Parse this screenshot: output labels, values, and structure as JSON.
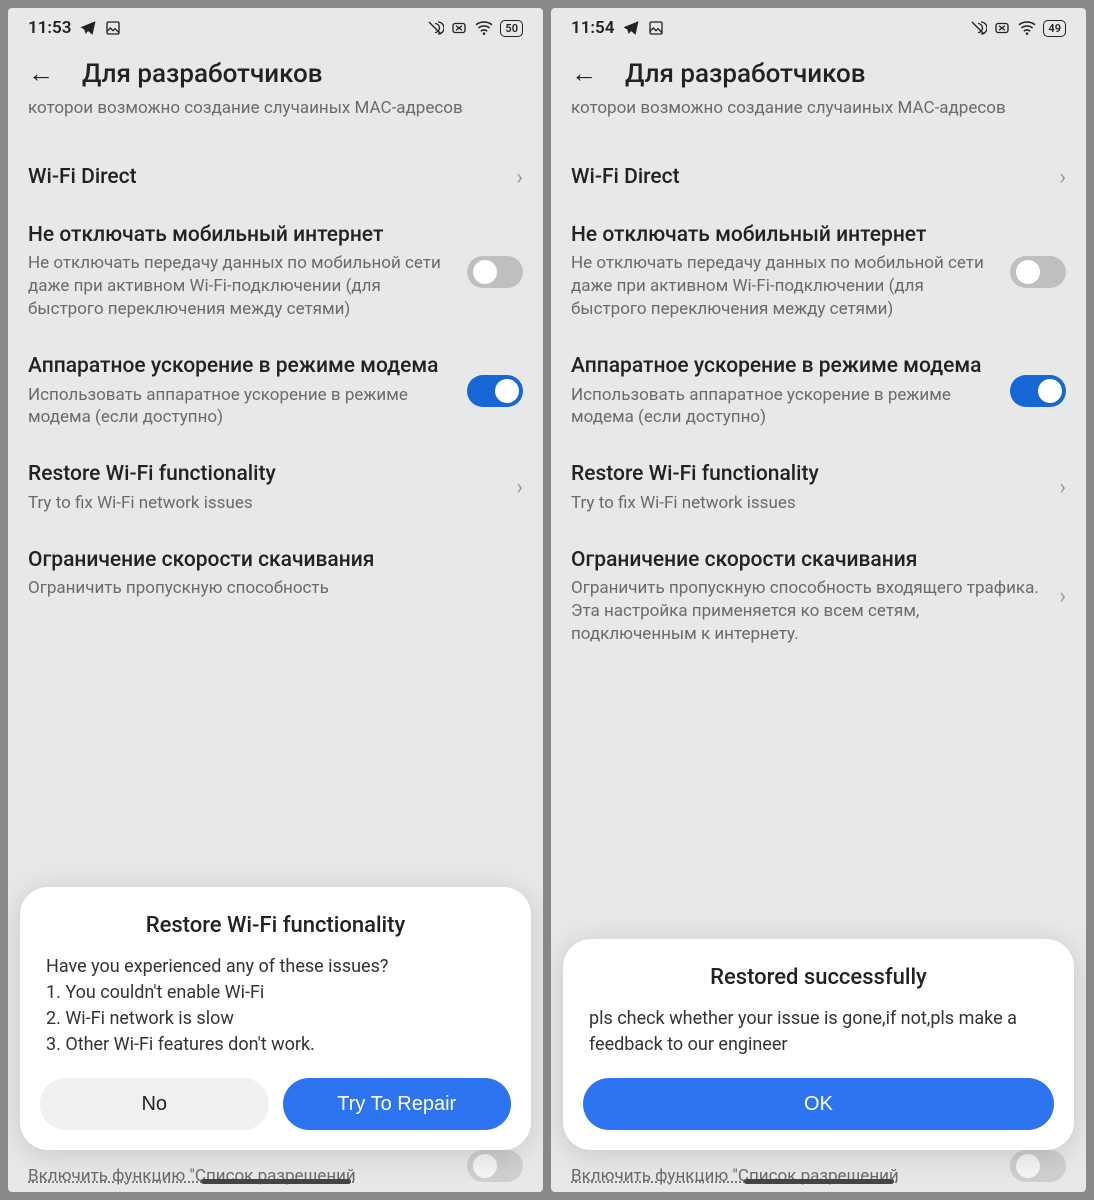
{
  "screens": [
    {
      "status": {
        "time": "11:53",
        "battery": "50"
      },
      "header": {
        "title": "Для разработчиков"
      },
      "trunc_desc": "которои возможно создание случаиных MAC-адресов",
      "items": {
        "wifi_direct": {
          "title": "Wi-Fi Direct"
        },
        "keep_mobile": {
          "title": "Не отключать мобильный интернет",
          "desc": "Не отключать передачу данных по мобильной сети даже при активном Wi-Fi-подключении (для быстрого переключения между сетями)"
        },
        "hw_accel": {
          "title": "Аппаратное ускорение в режиме модема",
          "desc": "Использовать аппаратное ускорение в режиме модема (если доступно)"
        },
        "restore_wifi": {
          "title": "Restore Wi-Fi functionality",
          "desc": "Try to fix Wi-Fi network issues"
        },
        "dl_limit": {
          "title": "Ограничение скорости скачивания",
          "desc": "Ограничить пропускную способность"
        }
      },
      "bottom_peek": "Включить функцию \"Список разрешений",
      "dialog": {
        "title": "Restore Wi-Fi functionality",
        "body_intro": "Have you experienced any of these issues?",
        "body_1": "1. You couldn't enable Wi-Fi",
        "body_2": "2. Wi-Fi network is slow",
        "body_3": "3. Other Wi-Fi features don't work.",
        "no": "No",
        "repair": "Try To Repair"
      }
    },
    {
      "status": {
        "time": "11:54",
        "battery": "49"
      },
      "header": {
        "title": "Для разработчиков"
      },
      "trunc_desc": "которои возможно создание случаиных MAC-адресов",
      "items": {
        "wifi_direct": {
          "title": "Wi-Fi Direct"
        },
        "keep_mobile": {
          "title": "Не отключать мобильный интернет",
          "desc": "Не отключать передачу данных по мобильной сети даже при активном Wi-Fi-подключении (для быстрого переключения между сетями)"
        },
        "hw_accel": {
          "title": "Аппаратное ускорение в режиме модема",
          "desc": "Использовать аппаратное ускорение в режиме модема (если доступно)"
        },
        "restore_wifi": {
          "title": "Restore Wi-Fi functionality",
          "desc": "Try to fix Wi-Fi network issues"
        },
        "dl_limit": {
          "title": "Ограничение скорости скачивания",
          "desc": "Ограничить пропускную способность входящего трафика. Эта настройка применяется ко всем сетям, подключенным к интернету."
        }
      },
      "bottom_peek": "Включить функцию \"Список разрешений",
      "dialog": {
        "title": "Restored successfully",
        "body": "pls check whether your issue is gone,if not,pls make a feedback to our engineer",
        "ok": "OK"
      }
    }
  ]
}
